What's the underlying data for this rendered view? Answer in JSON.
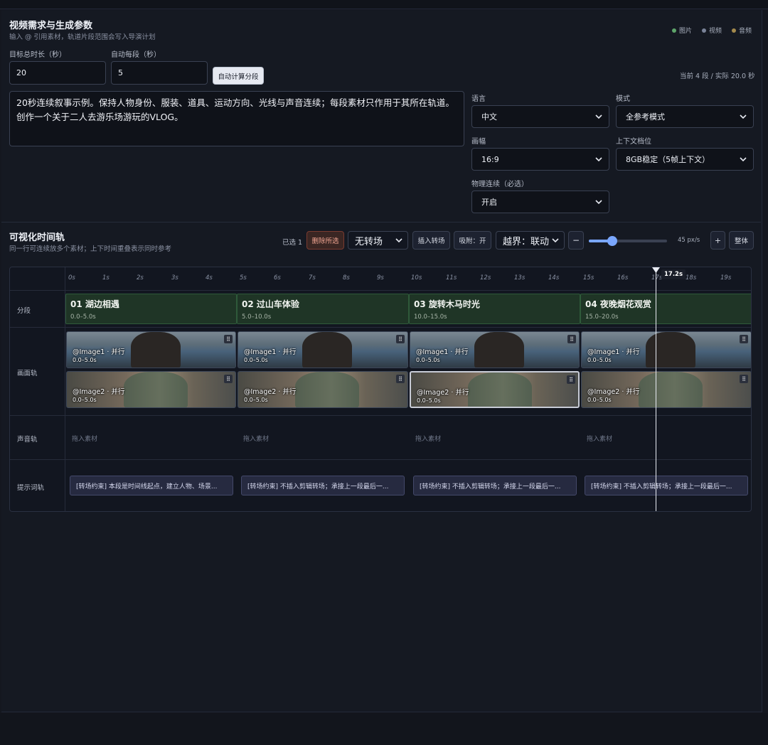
{
  "header": {
    "title": "视频需求与生成参数",
    "subtitle": "输入 @ 引用素材，轨道片段范围会写入导演计划",
    "legend": [
      {
        "label": "图片",
        "color": "#5ea56a"
      },
      {
        "label": "视频",
        "color": "#7a8398"
      },
      {
        "label": "音频",
        "color": "#a48a4c"
      }
    ]
  },
  "params": {
    "duration_label": "目标总时长（秒）",
    "duration_value": "20",
    "segment_label": "自动每段（秒）",
    "segment_value": "5",
    "auto_button": "自动计算分段",
    "status": "当前 4 段 / 实际 20.0 秒",
    "prompt_text": "20秒连续叙事示例。保持人物身份、服装、道具、运动方向、光线与声音连续；每段素材只作用于其所在轨道。\n创作一个关于二人去游乐场游玩的VLOG。",
    "language_label": "语言",
    "language_value": "中文",
    "mode_label": "模式",
    "mode_value": "全参考模式",
    "aspect_label": "画幅",
    "aspect_value": "16:9",
    "context_label": "上下文档位",
    "context_value": "8GB稳定（5帧上下文）",
    "physics_label": "物理连续（必选）",
    "physics_value": "开启"
  },
  "timeline": {
    "title": "可视化时间轨",
    "subtitle": "同一行可连续放多个素材；上下时间重叠表示同时参考",
    "selected": "已选 1",
    "delete_button": "删除所选",
    "transition_value": "无转场",
    "insert_transition": "插入转场",
    "snap": "吸附：开",
    "bounds_value": "越界：联动",
    "zoom_minus": "−",
    "zoom_value": 0.3,
    "zoom_label": "45 px/s",
    "zoom_plus": "+",
    "fit_button": "整体",
    "ticks": [
      "0s",
      "1s",
      "2s",
      "3s",
      "4s",
      "5s",
      "6s",
      "7s",
      "8s",
      "9s",
      "10s",
      "11s",
      "12s",
      "13s",
      "14s",
      "15s",
      "16s",
      "17s",
      "18s",
      "19s"
    ],
    "playhead": "17.2s",
    "row_labels": {
      "segments": "分段",
      "video": "画面轨",
      "audio": "声音轨",
      "prompt": "提示词轨"
    },
    "segments": [
      {
        "title": "01 湖边相遇",
        "time": "0.0–5.0s"
      },
      {
        "title": "02 过山车体验",
        "time": "5.0–10.0s"
      },
      {
        "title": "03 旋转木马时光",
        "time": "10.0–15.0s"
      },
      {
        "title": "04 夜晚烟花观赏",
        "time": "15.0–20.0s"
      }
    ],
    "clips_row1": [
      {
        "name": "@Image1 · 并行",
        "time": "0.0–5.0s"
      },
      {
        "name": "@Image1 · 并行",
        "time": "0.0–5.0s"
      },
      {
        "name": "@Image1 · 并行",
        "time": "0.0–5.0s"
      },
      {
        "name": "@Image1 · 并行",
        "time": "0.0–5.0s"
      }
    ],
    "clips_row2": [
      {
        "name": "@Image2 · 并行",
        "time": "0.0–5.0s"
      },
      {
        "name": "@Image2 · 并行",
        "time": "0.0–5.0s"
      },
      {
        "name": "@Image2 · 并行",
        "time": "0.0–5.0s"
      },
      {
        "name": "@Image2 · 并行",
        "time": "0.0–5.0s"
      }
    ],
    "audio_drop": [
      "拖入素材",
      "拖入素材",
      "拖入素材",
      "拖入素材"
    ],
    "prompts": [
      "[转场约束] 本段是时间线起点，建立人物、场景...",
      "[转场约束] 不插入剪辑转场；承接上一段最后一...",
      "[转场约束] 不插入剪辑转场；承接上一段最后一...",
      "[转场约束] 不插入剪辑转场；承接上一段最后一..."
    ],
    "grip_icon": "⠿"
  }
}
